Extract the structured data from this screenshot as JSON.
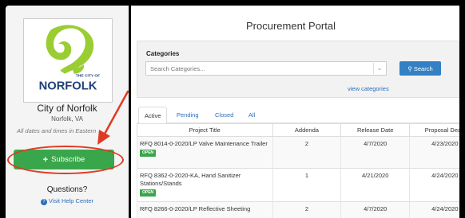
{
  "sidebar": {
    "logo_text_top": "THE CITY OF",
    "logo_text_main": "NORFOLK",
    "city_name": "City of Norfolk",
    "city_location": "Norfolk, VA",
    "timezone_note": "All dates and times in Eastern",
    "subscribe_label": "Subscribe",
    "questions_label": "Questions?",
    "help_label": "Visit Help Center"
  },
  "main": {
    "title": "Procurement Portal",
    "categories": {
      "label": "Categories",
      "placeholder": "Search Categories...",
      "search_label": "Search",
      "view_link": "view categories"
    },
    "tabs": [
      {
        "label": "Active"
      },
      {
        "label": "Pending"
      },
      {
        "label": "Closed"
      },
      {
        "label": "All"
      }
    ],
    "table": {
      "headers": [
        "Project Title",
        "Addenda",
        "Release Date",
        "Proposal Dead"
      ],
      "rows": [
        {
          "title": "RFQ 8014-0-2020/LP Valve Maintenance Trailer",
          "status": "OPEN",
          "addenda": "2",
          "release": "4/7/2020",
          "deadline": "4/23/2020"
        },
        {
          "title": "RFQ 8362-0-2020-KA, Hand Sanitizer Stations/Stands",
          "status": "OPEN",
          "addenda": "1",
          "release": "4/21/2020",
          "deadline": "4/24/2020"
        },
        {
          "title": "RFQ 8266-0-2020/LP Reflective Sheeting",
          "status": "",
          "addenda": "2",
          "release": "4/7/2020",
          "deadline": "4/24/2020"
        }
      ]
    }
  },
  "colors": {
    "subscribe_green": "#3aa64b",
    "annotation_red": "#e03a22",
    "link_blue": "#2a6ebb",
    "search_blue": "#3380c4",
    "logo_green": "#9acd32",
    "logo_navy": "#1f3f7a"
  },
  "icons": {
    "subscribe": "plus-icon",
    "search": "search-icon",
    "help": "question-circle-icon",
    "dropdown": "chevron-down-icon"
  }
}
